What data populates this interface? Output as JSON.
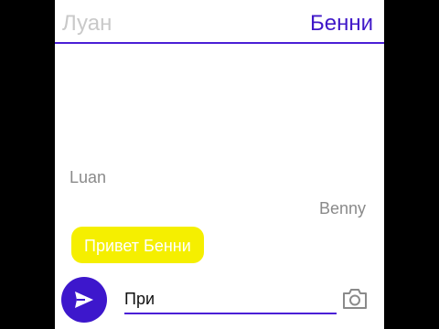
{
  "header": {
    "tab_left": "Луан",
    "tab_right": "Бенни",
    "accent_color": "#3f17c8",
    "inactive_color": "#c9c9c9"
  },
  "messages": {
    "sender_left": "Luan",
    "sender_right": "Benny",
    "bubble_text": "Привет Бенни",
    "bubble_color": "#f5ef00"
  },
  "composer": {
    "input_value": "При",
    "send_icon": "send-icon",
    "camera_icon": "camera-icon"
  }
}
